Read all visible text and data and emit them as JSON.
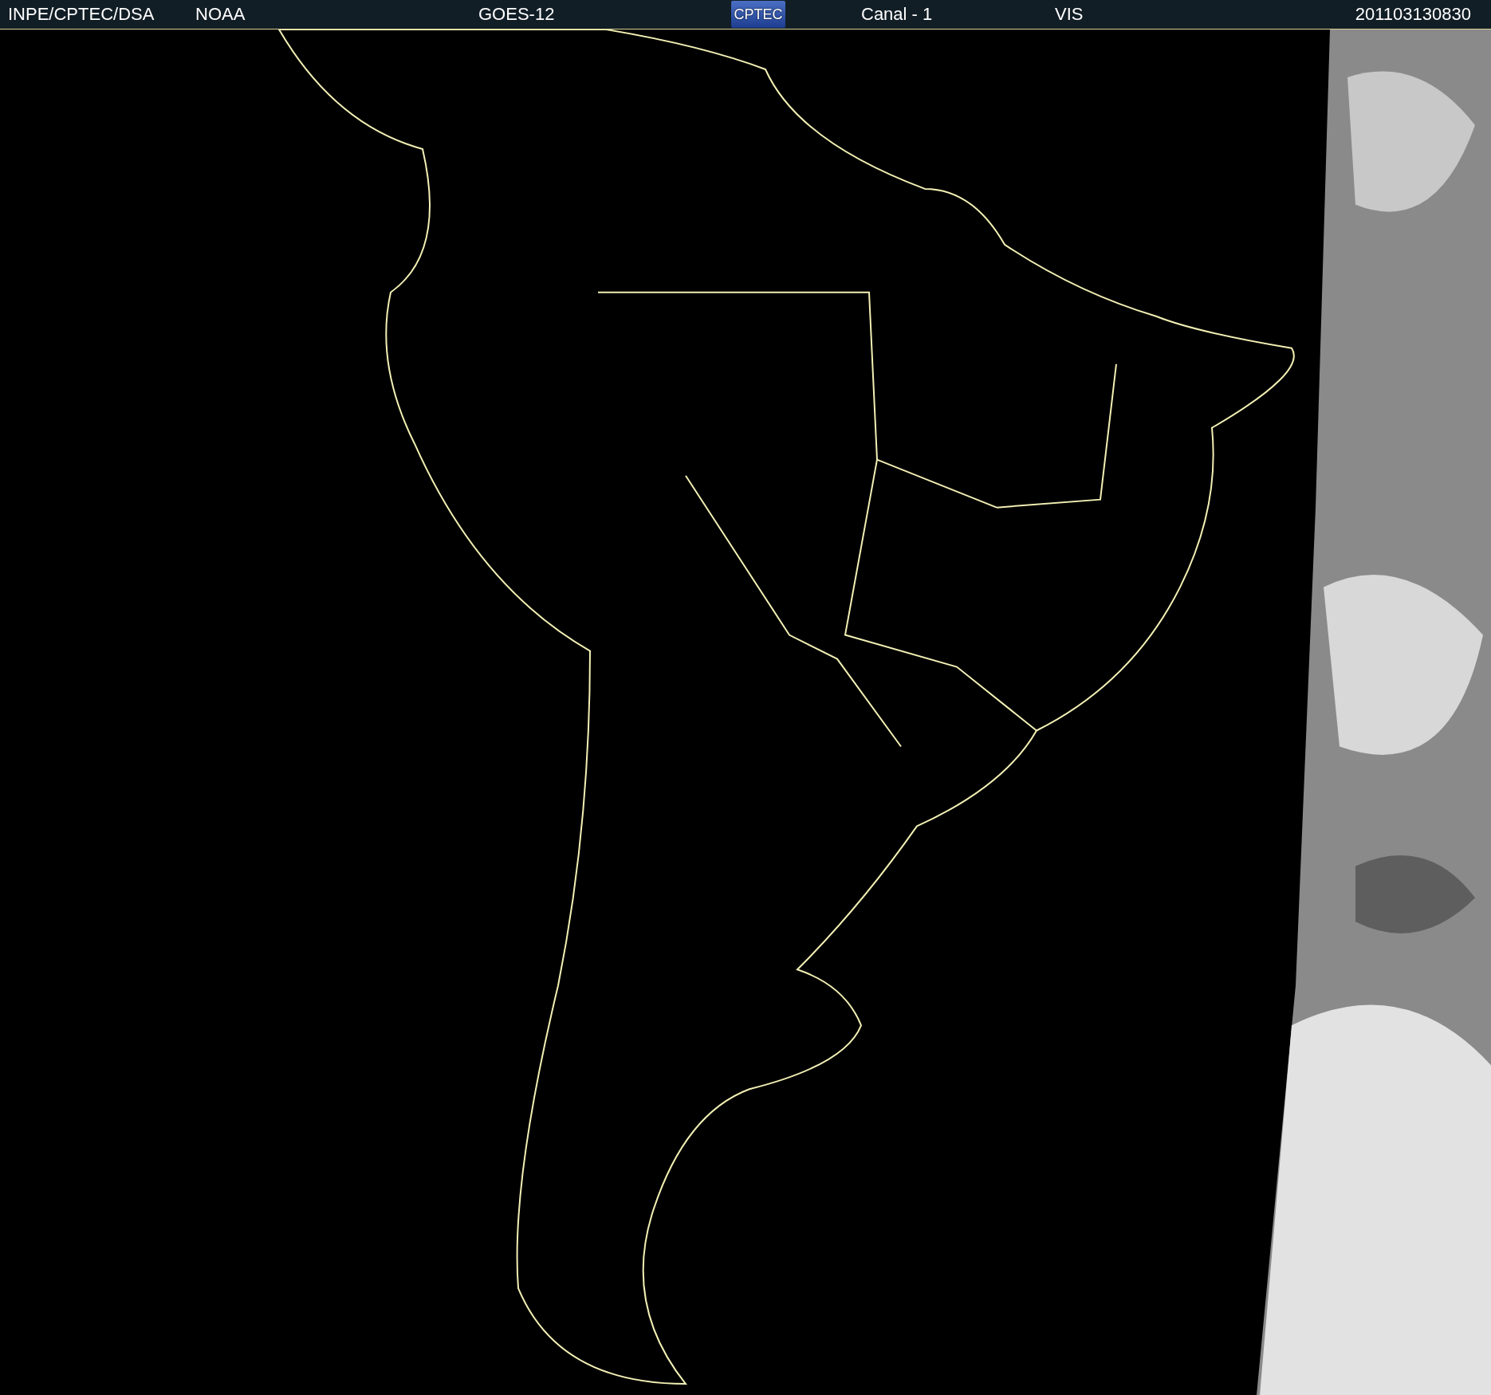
{
  "header": {
    "institution": "INPE/CPTEC/DSA",
    "agency": "NOAA",
    "satellite": "GOES-12",
    "logo": "CPTEC",
    "channel": "Canal - 1",
    "band": "VIS",
    "timestamp": "201103130830"
  }
}
